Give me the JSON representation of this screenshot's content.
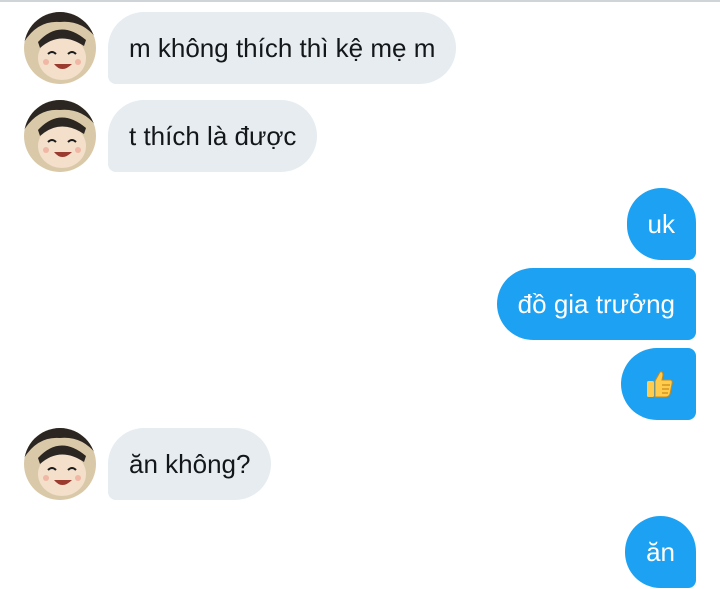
{
  "messages": [
    {
      "from": "them",
      "text": "m không thích thì kệ mẹ m"
    },
    {
      "from": "them",
      "text": "t thích là được"
    },
    {
      "from": "me",
      "text": "uk"
    },
    {
      "from": "me",
      "text": "đồ gia trưởng"
    },
    {
      "from": "me",
      "emoji": "thumbs-up-icon"
    },
    {
      "from": "them",
      "text": "ăn không?"
    },
    {
      "from": "me",
      "text": "ăn"
    }
  ],
  "colors": {
    "incoming_bubble": "#e6ecf0",
    "outgoing_bubble": "#1da1f2",
    "incoming_text": "#14171a",
    "outgoing_text": "#ffffff"
  }
}
